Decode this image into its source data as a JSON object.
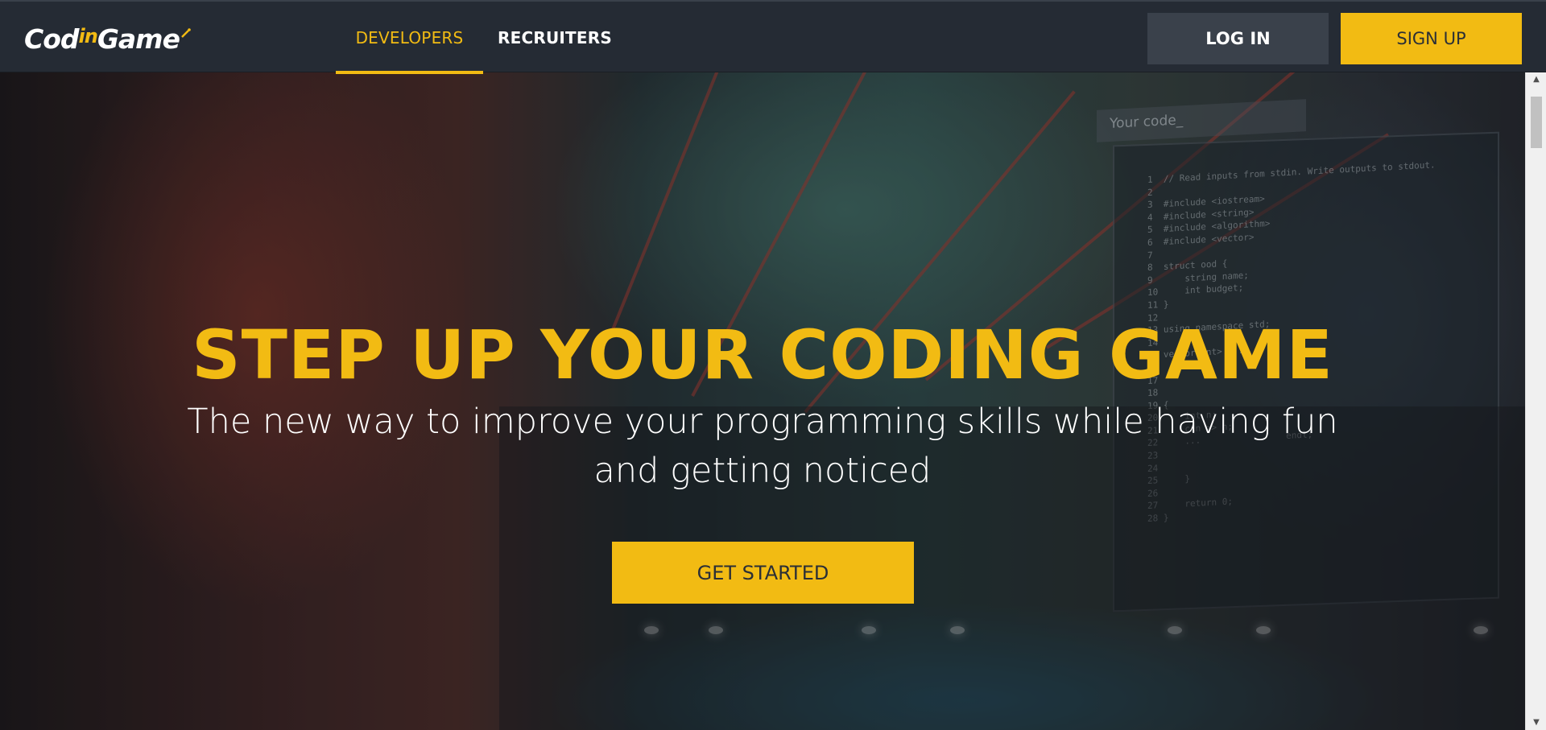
{
  "brand": {
    "name_part1": "Cod",
    "name_part2": "in",
    "name_part3": "Game"
  },
  "nav": {
    "developers": "DEVELOPERS",
    "recruiters": "RECRUITERS"
  },
  "auth": {
    "login": "LOG IN",
    "signup": "SIGN UP"
  },
  "hero": {
    "headline": "STEP UP YOUR CODING GAME",
    "subline": "The new way to improve your programming skills while having fun and getting noticed",
    "cta": "GET STARTED"
  },
  "code_panel": {
    "tab": "Your code_",
    "lines": "1  // Read inputs from stdin. Write outputs to stdout.\n2\n3  #include <iostream>\n4  #include <string>\n5  #include <algorithm>\n6  #include <vector>\n7\n8  struct ood {\n9      string name;\n10     int budget;\n11 }\n12\n13 using namespace std;\n14\n15 vector<int> ...\n16\n17\n18\n19 {\n20     int n;\n21     cin >> n;\n22     ...                endl;\n23\n24\n25     }\n26\n27     return 0;\n28 }"
  },
  "colors": {
    "accent": "#f2bb13",
    "topbar": "#252b34",
    "login_bg": "#3a414b"
  }
}
